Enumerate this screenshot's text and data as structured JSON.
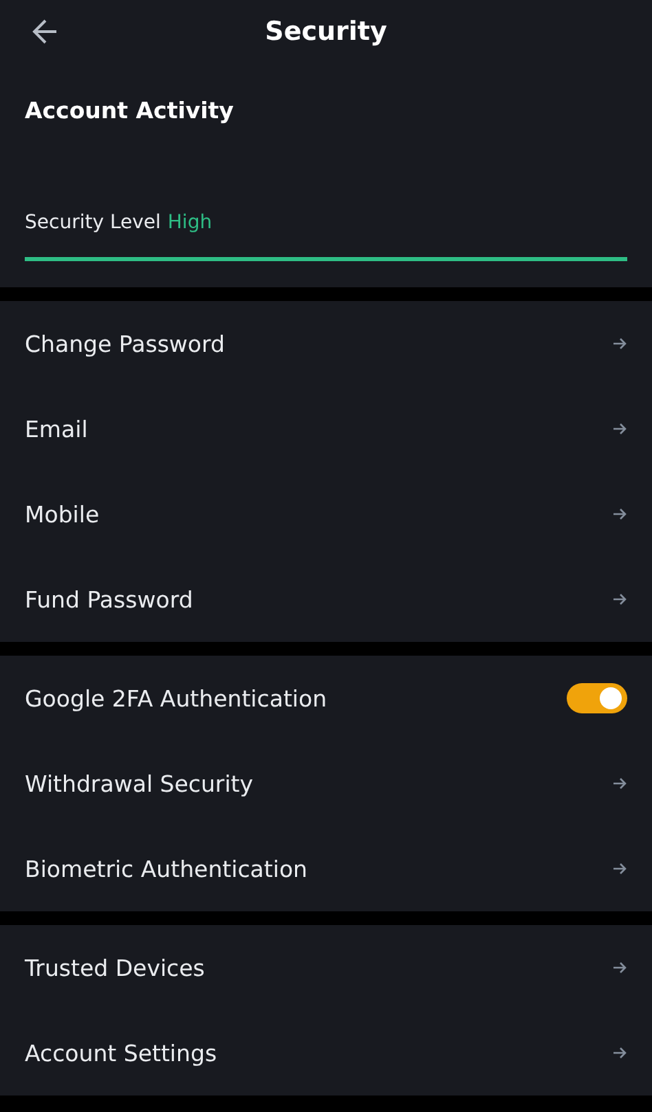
{
  "header": {
    "title": "Security"
  },
  "account_activity": {
    "label": "Account Activity"
  },
  "security_level": {
    "label": "Security Level",
    "value": "High",
    "level": 1
  },
  "sections": [
    {
      "items": [
        {
          "label": "Change Password",
          "kind": "link"
        },
        {
          "label": "Email",
          "kind": "link"
        },
        {
          "label": "Mobile",
          "kind": "link"
        },
        {
          "label": "Fund Password",
          "kind": "link"
        }
      ]
    },
    {
      "items": [
        {
          "label": "Google 2FA Authentication",
          "kind": "toggle",
          "on": true
        },
        {
          "label": "Withdrawal Security",
          "kind": "link"
        },
        {
          "label": "Biometric Authentication",
          "kind": "link"
        }
      ]
    },
    {
      "items": [
        {
          "label": "Trusted Devices",
          "kind": "link"
        },
        {
          "label": "Account Settings",
          "kind": "link"
        }
      ]
    }
  ]
}
